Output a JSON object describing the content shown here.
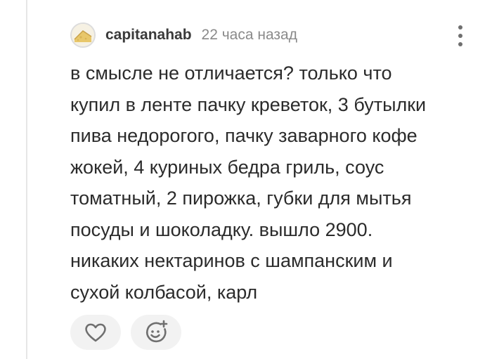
{
  "comment": {
    "username": "capitanahab",
    "timestamp": "22 часа назад",
    "lines": [
      "в смысле не отличается? только что",
      "купил в ленте пачку креветок, 3 бутылки",
      "пива недорогого, пачку заварного кофе",
      "жокей, 4 куриных бедра гриль, соус",
      "томатный, 2 пирожка, губки для мытья",
      "посуды и шоколадку. вышло 2900.",
      "никаких нектаринов с шампанским и",
      "сухой колбасой, карл"
    ]
  },
  "icons": {
    "avatar": "avatar",
    "more": "more-vertical-icon",
    "like": "heart-icon",
    "react": "smile-add-icon"
  },
  "colors": {
    "text": "#2b2b2b",
    "muted": "#8a8a8a",
    "button_bg": "#f2f2f2",
    "icon": "#6f6f6f"
  }
}
